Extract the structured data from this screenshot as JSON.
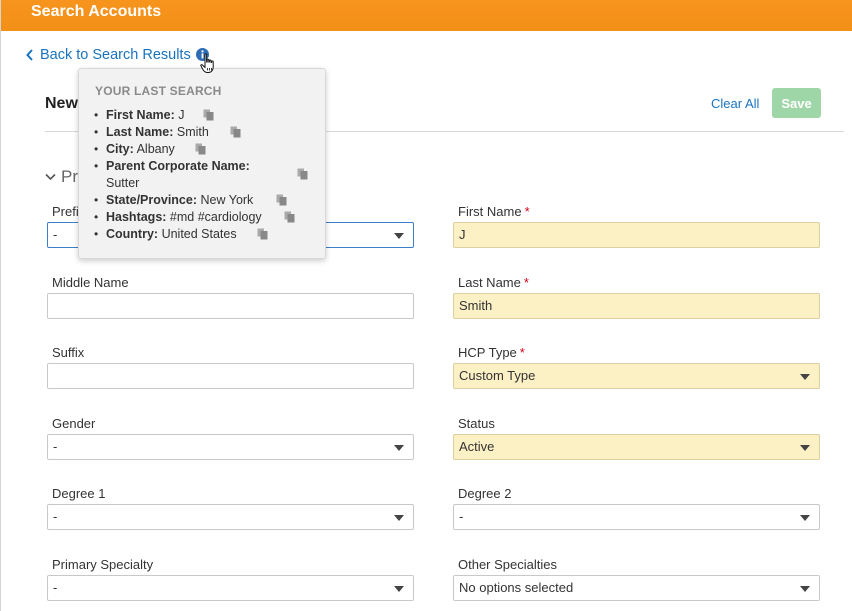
{
  "header": {
    "title": "Search Accounts"
  },
  "nav": {
    "back_label": "Back to Search Results"
  },
  "form": {
    "title": "New",
    "clear_all": "Clear All",
    "save": "Save",
    "section_title": "Pr"
  },
  "popover": {
    "heading": "YOUR LAST SEARCH",
    "items": [
      {
        "label": "First Name:",
        "value": "J"
      },
      {
        "label": "Last Name:",
        "value": "Smith"
      },
      {
        "label": "City:",
        "value": "Albany"
      },
      {
        "label": "Parent Corporate Name:",
        "value": "Sutter"
      },
      {
        "label": "State/Province:",
        "value": "New York"
      },
      {
        "label": "Hashtags:",
        "value": "#md #cardiology"
      },
      {
        "label": "Country:",
        "value": "United States"
      }
    ]
  },
  "fields": {
    "prefix": {
      "label": "Prefi",
      "value": "-"
    },
    "first_name": {
      "label": "First Name",
      "required_mark": "*",
      "value": "J"
    },
    "middle_name": {
      "label": "Middle Name",
      "value": ""
    },
    "last_name": {
      "label": "Last Name",
      "required_mark": "*",
      "value": "Smith"
    },
    "suffix": {
      "label": "Suffix",
      "value": ""
    },
    "hcp_type": {
      "label": "HCP Type",
      "required_mark": "*",
      "value": "Custom Type"
    },
    "gender": {
      "label": "Gender",
      "value": "-"
    },
    "status": {
      "label": "Status",
      "value": "Active"
    },
    "degree1": {
      "label": "Degree 1",
      "value": "-"
    },
    "degree2": {
      "label": "Degree 2",
      "value": "-"
    },
    "primary_specialty": {
      "label": "Primary Specialty",
      "value": "-"
    },
    "other_specialties": {
      "label": "Other Specialties",
      "value": "No options selected"
    }
  },
  "colors": {
    "header_bg": "#f7941d",
    "link": "#1a73c0",
    "save_button": "#9fd6a7",
    "required_field_bg": "#fcf0c5",
    "required_mark": "#d0021b"
  },
  "icons": {
    "back": "chevron-left-icon",
    "info": "info-icon",
    "cursor": "hand-pointer-icon",
    "copy": "copy-icon",
    "dropdown": "caret-down-icon",
    "section": "chevron-down-icon"
  }
}
